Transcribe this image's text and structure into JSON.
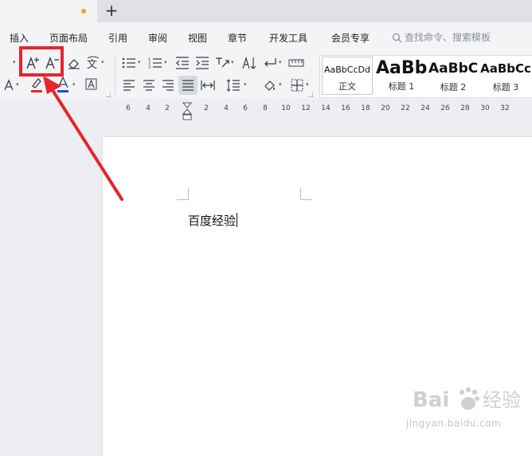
{
  "tabbar": {
    "new_tab_symbol": "+",
    "unsaved_dot_color": "#f0a320"
  },
  "menu": {
    "items": [
      "插入",
      "页面布局",
      "引用",
      "审阅",
      "视图",
      "章节",
      "开发工具",
      "会员专享"
    ],
    "search_placeholder": "查找命令、搜索模板"
  },
  "ribbon": {
    "styles": [
      {
        "preview": "AaBbCcDd",
        "name": "正文"
      },
      {
        "preview": "AaBb",
        "name": "标题 1"
      },
      {
        "preview": "AaBbC",
        "name": "标题 2"
      },
      {
        "preview": "AaBbCc",
        "name": "标题 3"
      }
    ],
    "font_color_bar": "#1d4ed8",
    "highlight_color_bar": "#e8242c"
  },
  "annotation": {
    "color": "#e8242c"
  },
  "ruler": {
    "numbers": [
      "6",
      "4",
      "2",
      "2",
      "4",
      "6",
      "8",
      "10",
      "12",
      "14",
      "16",
      "18",
      "20",
      "22",
      "24",
      "26",
      "28",
      "30",
      "32"
    ]
  },
  "document": {
    "text": "百度经验"
  },
  "watermark": {
    "text": "Bai 经验",
    "subtext": "jingyan.baidu.com"
  }
}
